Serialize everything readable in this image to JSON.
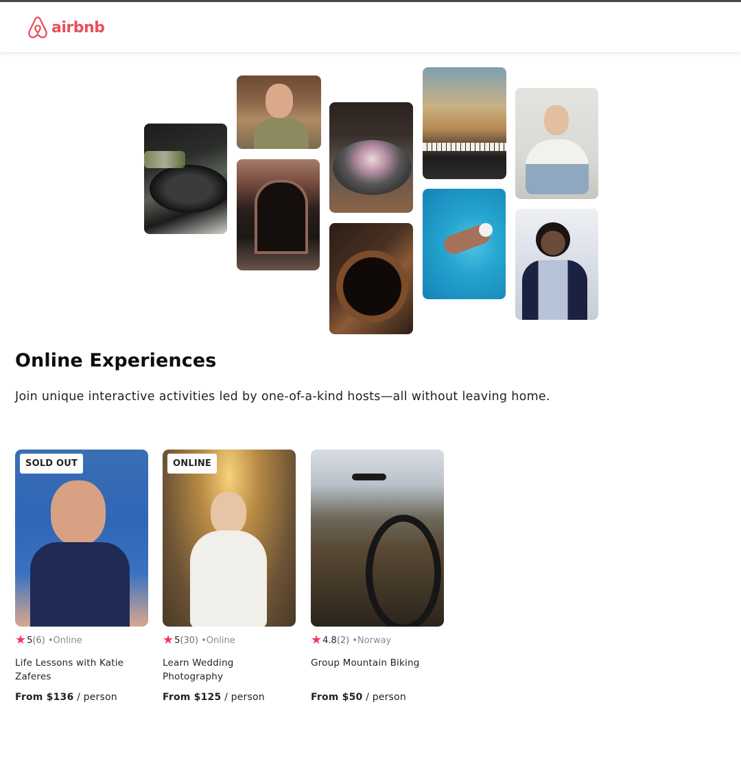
{
  "brand": {
    "name": "airbnb",
    "color": "#e8505b"
  },
  "hero": {
    "title": "Online Experiences",
    "subtitle": "Join unique interactive activities led by one-of-a-kind hosts—all without leaving home."
  },
  "colors": {
    "star": "#f5385c",
    "text": "#222222",
    "muted": "#717171"
  },
  "cards": [
    {
      "badge": "SOLD OUT",
      "rating": "5",
      "count": "(6)",
      "location": "•Online",
      "name": "Life Lessons with Katie Zaferes",
      "price": "From $136",
      "per": " / person"
    },
    {
      "badge": "ONLINE",
      "rating": "5",
      "count": "(30)",
      "location": "•Online",
      "name": "Learn Wedding Photography",
      "price": "From $125",
      "per": " / person"
    },
    {
      "badge": "",
      "rating": "4.8",
      "count": "(2)",
      "location": "•Norway",
      "name": "Group Mountain Biking",
      "price": "From $50",
      "per": " / person"
    }
  ]
}
